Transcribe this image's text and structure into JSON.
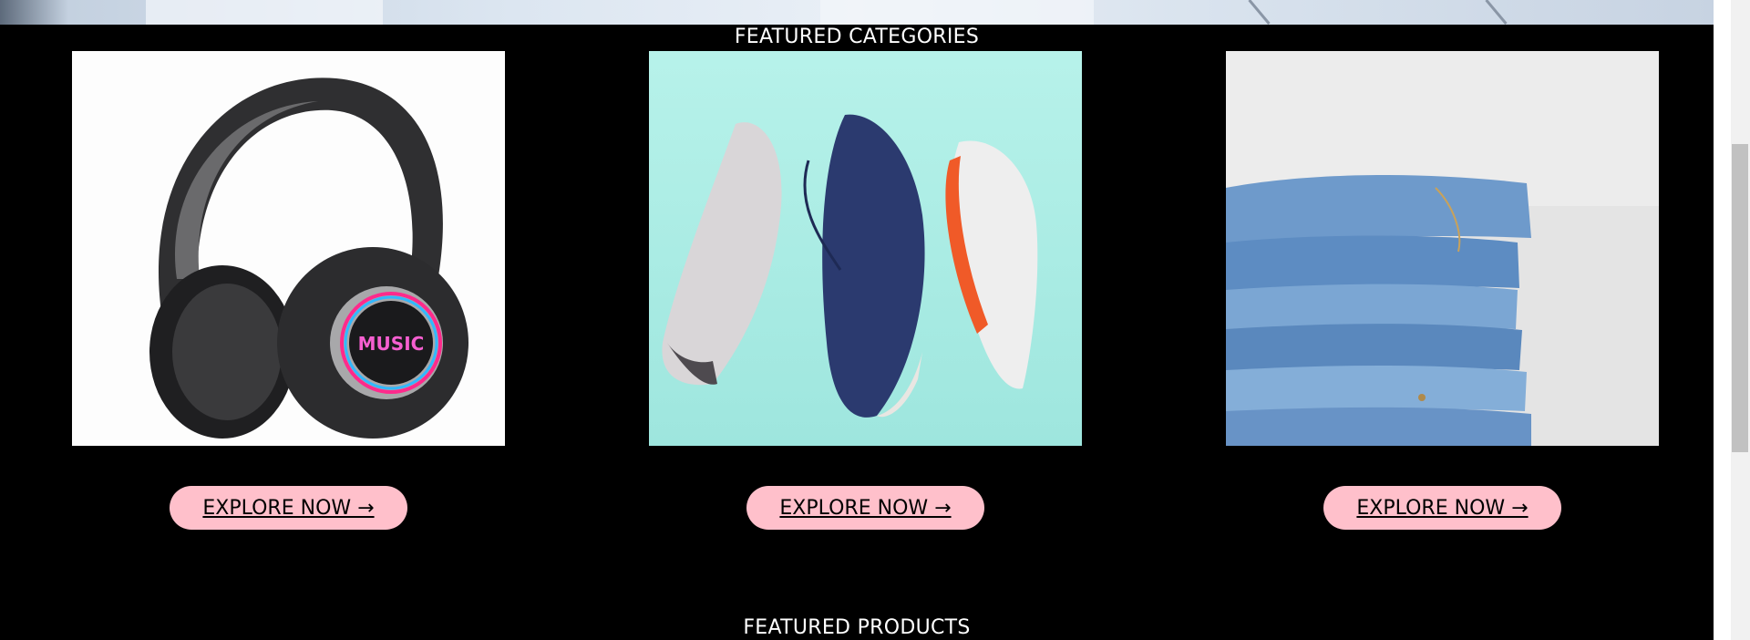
{
  "sections": {
    "featured_categories_title": "FEATURED CATEGORIES",
    "featured_products_title": "FEATURED PRODUCTS"
  },
  "categories": [
    {
      "image": "headphones-image",
      "button_label": "EXPLORE NOW →"
    },
    {
      "image": "sneakers-image",
      "button_label": "EXPLORE NOW →"
    },
    {
      "image": "jeans-image",
      "button_label": "EXPLORE NOW →"
    }
  ],
  "colors": {
    "background": "#000000",
    "button": "#ffc0cb",
    "sneaker_backdrop": "#b0efe7"
  }
}
